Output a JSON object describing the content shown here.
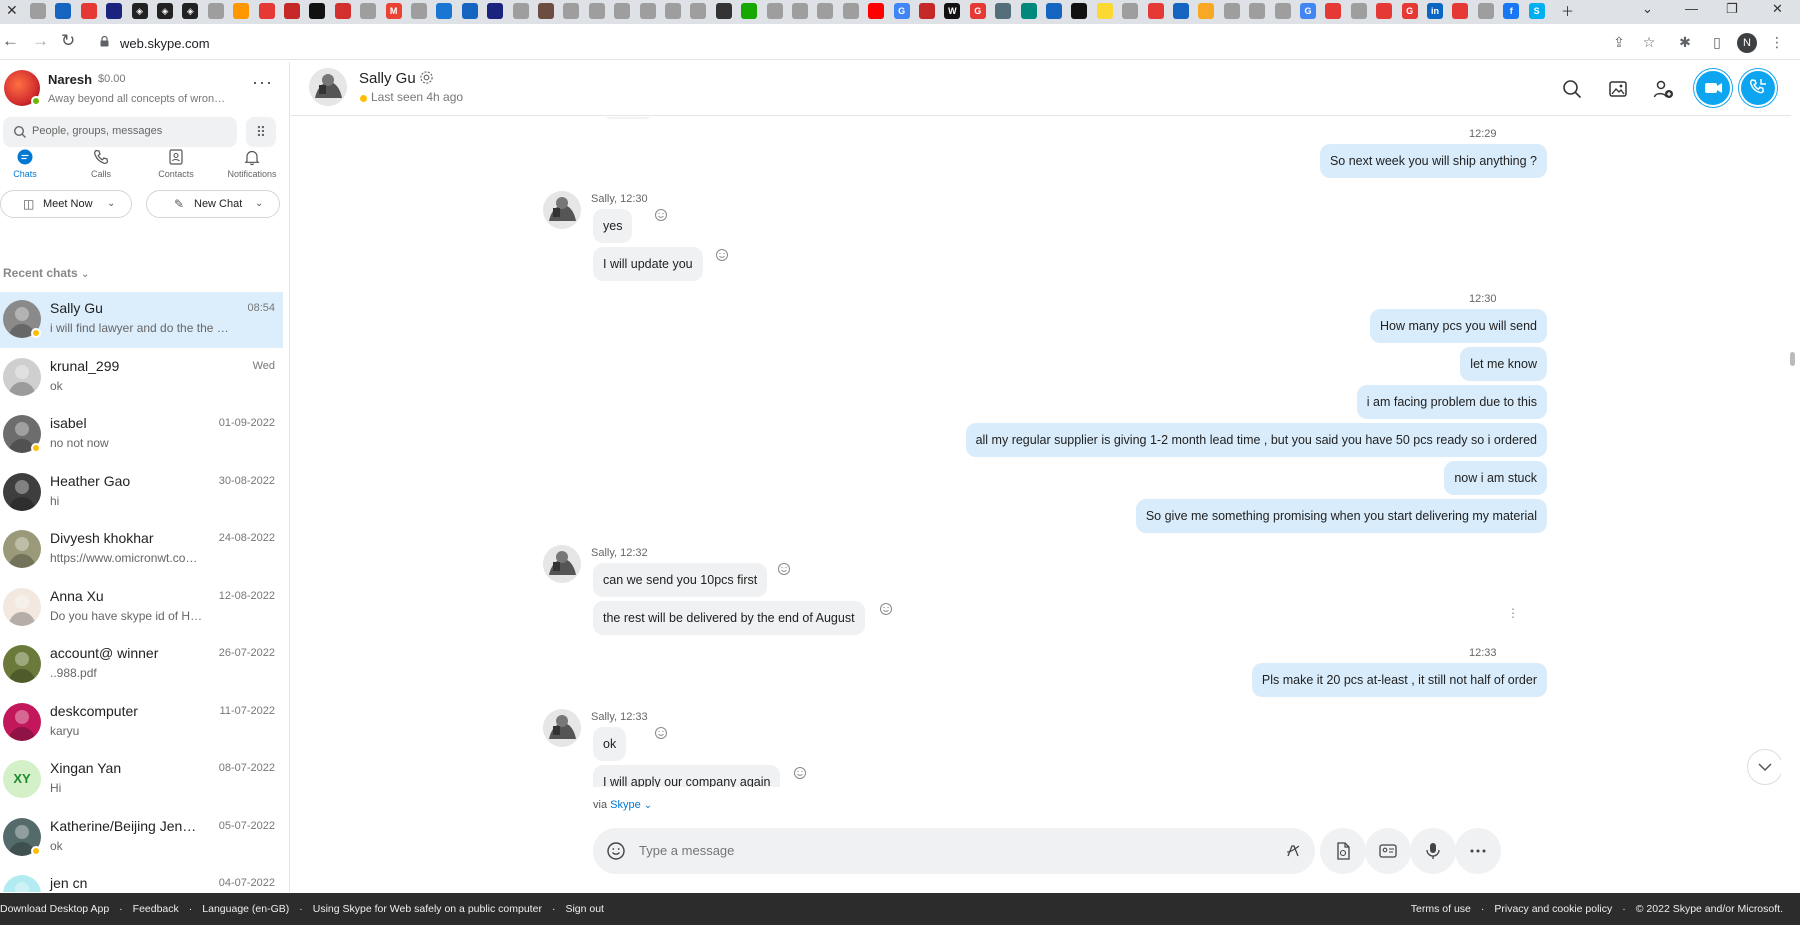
{
  "browser": {
    "url": "web.skype.com",
    "tab_icons": [
      {
        "name": "skype-tab-icon",
        "color": "#9e9e9e",
        "glyph": ""
      },
      {
        "name": "tab-icon",
        "color": "#1565c0",
        "glyph": ""
      },
      {
        "name": "tab-icon",
        "color": "#e53935",
        "glyph": ""
      },
      {
        "name": "tab-icon",
        "color": "#1a237e",
        "glyph": ""
      },
      {
        "name": "tab-icon",
        "color": "#222",
        "glyph": "◈"
      },
      {
        "name": "tab-icon",
        "color": "#222",
        "glyph": "◈"
      },
      {
        "name": "tab-icon",
        "color": "#222",
        "glyph": "◈"
      },
      {
        "name": "tab-icon",
        "color": "#9e9e9e",
        "glyph": ""
      },
      {
        "name": "tab-icon",
        "color": "#ff9800",
        "glyph": ""
      },
      {
        "name": "tab-icon",
        "color": "#e53935",
        "glyph": ""
      },
      {
        "name": "tab-icon",
        "color": "#c62828",
        "glyph": ""
      },
      {
        "name": "tab-icon",
        "color": "#111",
        "glyph": ""
      },
      {
        "name": "tab-icon",
        "color": "#d32f2f",
        "glyph": ""
      },
      {
        "name": "tab-icon",
        "color": "#9e9e9e",
        "glyph": ""
      },
      {
        "name": "gmail-tab-icon",
        "color": "#ea4335",
        "glyph": "M"
      },
      {
        "name": "tab-icon",
        "color": "#9e9e9e",
        "glyph": ""
      },
      {
        "name": "tab-icon",
        "color": "#1976d2",
        "glyph": ""
      },
      {
        "name": "tab-icon",
        "color": "#1565c0",
        "glyph": ""
      },
      {
        "name": "tab-icon",
        "color": "#1a237e",
        "glyph": ""
      },
      {
        "name": "tab-icon",
        "color": "#9e9e9e",
        "glyph": ""
      },
      {
        "name": "tab-icon",
        "color": "#6d4c41",
        "glyph": ""
      },
      {
        "name": "tab-icon",
        "color": "#9e9e9e",
        "glyph": ""
      },
      {
        "name": "tab-icon",
        "color": "#9e9e9e",
        "glyph": ""
      },
      {
        "name": "tab-icon",
        "color": "#9e9e9e",
        "glyph": ""
      },
      {
        "name": "tab-icon",
        "color": "#9e9e9e",
        "glyph": ""
      },
      {
        "name": "tab-icon",
        "color": "#9e9e9e",
        "glyph": ""
      },
      {
        "name": "tab-icon",
        "color": "#9e9e9e",
        "glyph": ""
      },
      {
        "name": "tab-icon",
        "color": "#333",
        "glyph": ""
      },
      {
        "name": "upwork-tab-icon",
        "color": "#14a800",
        "glyph": ""
      },
      {
        "name": "tab-icon",
        "color": "#9e9e9e",
        "glyph": ""
      },
      {
        "name": "tab-icon",
        "color": "#9e9e9e",
        "glyph": ""
      },
      {
        "name": "tab-icon",
        "color": "#9e9e9e",
        "glyph": ""
      },
      {
        "name": "tab-icon",
        "color": "#9e9e9e",
        "glyph": ""
      },
      {
        "name": "youtube-tab-icon",
        "color": "#ff0000",
        "glyph": ""
      },
      {
        "name": "google-tab-icon",
        "color": "#4285f4",
        "glyph": "G"
      },
      {
        "name": "tab-icon",
        "color": "#c62828",
        "glyph": ""
      },
      {
        "name": "tab-icon",
        "color": "#111",
        "glyph": "W"
      },
      {
        "name": "tab-icon",
        "color": "#e53935",
        "glyph": "G"
      },
      {
        "name": "tab-icon",
        "color": "#546e7a",
        "glyph": ""
      },
      {
        "name": "tab-icon",
        "color": "#00897b",
        "glyph": ""
      },
      {
        "name": "tab-icon",
        "color": "#1565c0",
        "glyph": ""
      },
      {
        "name": "tab-icon",
        "color": "#111",
        "glyph": ""
      },
      {
        "name": "tab-icon",
        "color": "#fdd835",
        "glyph": ""
      },
      {
        "name": "tab-icon",
        "color": "#9e9e9e",
        "glyph": ""
      },
      {
        "name": "tab-icon",
        "color": "#e53935",
        "glyph": ""
      },
      {
        "name": "tab-icon",
        "color": "#1565c0",
        "glyph": ""
      },
      {
        "name": "tab-icon",
        "color": "#f9a825",
        "glyph": ""
      },
      {
        "name": "tab-icon",
        "color": "#9e9e9e",
        "glyph": ""
      },
      {
        "name": "tab-icon",
        "color": "#9e9e9e",
        "glyph": ""
      },
      {
        "name": "tab-icon",
        "color": "#9e9e9e",
        "glyph": ""
      },
      {
        "name": "google-tab-icon",
        "color": "#4285f4",
        "glyph": "G"
      },
      {
        "name": "tab-icon",
        "color": "#e53935",
        "glyph": ""
      },
      {
        "name": "tab-icon",
        "color": "#9e9e9e",
        "glyph": ""
      },
      {
        "name": "tab-icon",
        "color": "#e53935",
        "glyph": ""
      },
      {
        "name": "tab-icon",
        "color": "#e53935",
        "glyph": "G"
      },
      {
        "name": "linkedin-tab-icon",
        "color": "#0a66c2",
        "glyph": "in"
      },
      {
        "name": "tab-icon",
        "color": "#e53935",
        "glyph": ""
      },
      {
        "name": "tab-icon",
        "color": "#9e9e9e",
        "glyph": ""
      },
      {
        "name": "facebook-tab-icon",
        "color": "#1877f2",
        "glyph": "f"
      },
      {
        "name": "skype-tab-icon",
        "color": "#00aff0",
        "glyph": "S"
      }
    ]
  },
  "profile": {
    "name": "Naresh",
    "credit": "$0.00",
    "mood": "Away beyond all concepts of wron…",
    "browser_initial": "N"
  },
  "search": {
    "placeholder": "People, groups, messages"
  },
  "nav_tabs": [
    {
      "label": "Chats",
      "icon": "chat-bubble-icon",
      "active": true
    },
    {
      "label": "Calls",
      "icon": "phone-icon",
      "active": false
    },
    {
      "label": "Contacts",
      "icon": "contacts-icon",
      "active": false
    },
    {
      "label": "Notifications",
      "icon": "bell-icon",
      "active": false
    }
  ],
  "actions": {
    "meet_now": "Meet Now",
    "new_chat": "New Chat"
  },
  "recent_chats_label": "Recent chats",
  "chats": [
    {
      "name": "Sally Gu",
      "time": "08:54",
      "preview": "i will find lawyer and do the the …",
      "status_dot": true,
      "selected": true,
      "avatar_color": "#8a8a8a",
      "avatar_text": ""
    },
    {
      "name": "krunal_299",
      "time": "Wed",
      "preview": "ok",
      "status_dot": false,
      "selected": false,
      "avatar_color": "#cfcfcf",
      "avatar_text": ""
    },
    {
      "name": "isabel",
      "time": "01-09-2022",
      "preview": "no not now",
      "status_dot": true,
      "selected": false,
      "avatar_color": "#6d6d6d",
      "avatar_text": ""
    },
    {
      "name": "Heather Gao",
      "time": "30-08-2022",
      "preview": "hi",
      "status_dot": false,
      "selected": false,
      "avatar_color": "#3e3e3e",
      "avatar_text": ""
    },
    {
      "name": "Divyesh khokhar",
      "time": "24-08-2022",
      "preview": "https://www.omicronwt.co…",
      "status_dot": false,
      "selected": false,
      "avatar_color": "#9a9a7a",
      "avatar_text": ""
    },
    {
      "name": "Anna Xu",
      "time": "12-08-2022",
      "preview": "Do you have skype id of H…",
      "status_dot": false,
      "selected": false,
      "avatar_color": "#f2e8e0",
      "avatar_text": ""
    },
    {
      "name": "account@ winner",
      "time": "26-07-2022",
      "preview": "..988.pdf",
      "status_dot": false,
      "selected": false,
      "avatar_color": "#6b7a3a",
      "avatar_text": ""
    },
    {
      "name": "deskcomputer",
      "time": "11-07-2022",
      "preview": "karyu",
      "status_dot": false,
      "selected": false,
      "avatar_color": "#c2185b",
      "avatar_text": ""
    },
    {
      "name": "Xingan  Yan",
      "time": "08-07-2022",
      "preview": "Hi",
      "status_dot": false,
      "selected": false,
      "avatar_color": "#d4f0c8",
      "avatar_text": "XY"
    },
    {
      "name": "Katherine/Beijing Jen…",
      "time": "05-07-2022",
      "preview": "ok",
      "status_dot": true,
      "selected": false,
      "avatar_color": "#556b6b",
      "avatar_text": ""
    },
    {
      "name": "jen cn",
      "time": "04-07-2022",
      "preview": "",
      "status_dot": false,
      "selected": false,
      "avatar_color": "#b2ebf2",
      "avatar_text": ""
    }
  ],
  "conversation": {
    "contact_name": "Sally Gu",
    "last_seen": "Last seen 4h ago",
    "via_prefix": "via",
    "via_link": "Skype",
    "compose_placeholder": "Type a message",
    "timestamps_out": [
      "12:29",
      "12:30",
      "12:33"
    ],
    "timestamps_in": [
      "Sally, 12:30",
      "Sally, 12:32",
      "Sally, 12:33"
    ],
    "outgoing": [
      "So next week you will ship anything ?",
      "How many pcs you will send",
      "let me know",
      "i am facing problem due to this",
      "all my regular supplier is giving 1-2 month lead time , but you said you have 50 pcs ready so i ordered",
      "now i am stuck",
      "So give me something promising when you start delivering my material",
      "Pls make it 20 pcs at-least , it still not half of order"
    ],
    "incoming": [
      "yes",
      "I will update you",
      "can we send you 10pcs first",
      "the rest will be delivered by the end of August",
      "ok",
      "I will apply our company again"
    ]
  },
  "footer": {
    "left": [
      "Download Desktop App",
      "·",
      "Feedback",
      "·",
      "Language (en-GB)",
      "·",
      "Using Skype for Web safely on a public computer",
      "·",
      "Sign out"
    ],
    "right": [
      "Terms of use",
      "·",
      "Privacy and cookie policy",
      "·",
      "© 2022 Skype and/or Microsoft."
    ]
  },
  "colors": {
    "accent": "#0078d4",
    "call_button": "#0ea5f0",
    "outgoing_bubble": "#d9ecfb",
    "incoming_bubble": "#f0f1f3",
    "selected_chat": "#dcedfb",
    "away_status": "#ffbf00",
    "online_status": "#6bb700"
  }
}
